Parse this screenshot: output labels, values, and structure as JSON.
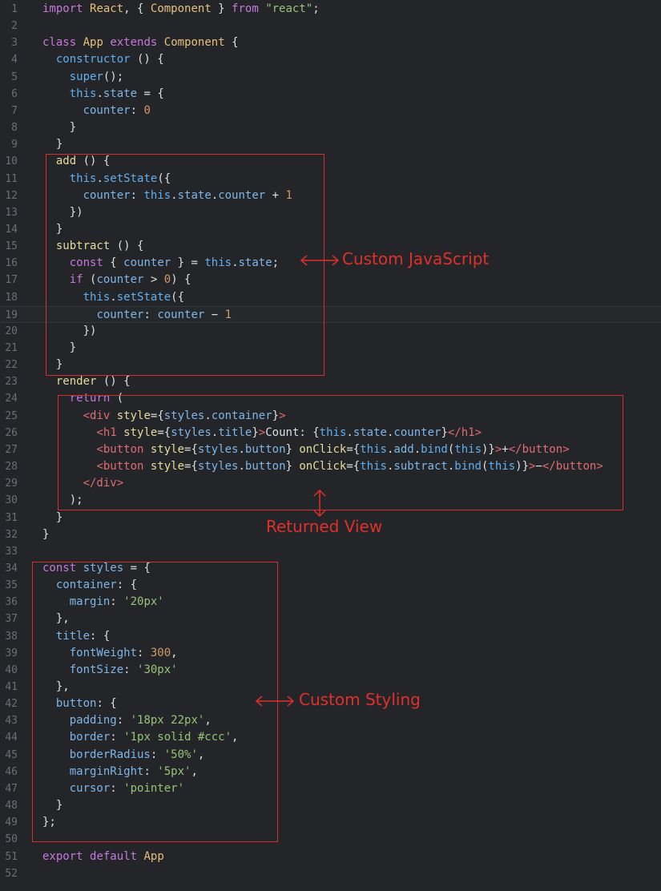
{
  "editor": {
    "lines": [
      [
        [
          "kw",
          "import"
        ],
        [
          "pl",
          " "
        ],
        [
          "cls",
          "React"
        ],
        [
          "pl",
          ", { "
        ],
        [
          "cls",
          "Component"
        ],
        [
          "pl",
          " } "
        ],
        [
          "kw",
          "from"
        ],
        [
          "pl",
          " "
        ],
        [
          "str",
          "\"react\""
        ],
        [
          "pl",
          ";"
        ]
      ],
      [],
      [
        [
          "kw",
          "class"
        ],
        [
          "pl",
          " "
        ],
        [
          "cls",
          "App"
        ],
        [
          "pl",
          " "
        ],
        [
          "kw",
          "extends"
        ],
        [
          "pl",
          " "
        ],
        [
          "cls",
          "Component"
        ],
        [
          "pl",
          " {"
        ]
      ],
      [
        [
          "pl",
          "  "
        ],
        [
          "fn",
          "constructor"
        ],
        [
          "pl",
          " () {"
        ]
      ],
      [
        [
          "pl",
          "    "
        ],
        [
          "fn",
          "super"
        ],
        [
          "pl",
          "();"
        ]
      ],
      [
        [
          "pl",
          "    "
        ],
        [
          "fn",
          "this"
        ],
        [
          "pl",
          "."
        ],
        [
          "prop",
          "state"
        ],
        [
          "pl",
          " = {"
        ]
      ],
      [
        [
          "pl",
          "      "
        ],
        [
          "prop",
          "counter"
        ],
        [
          "pl",
          ": "
        ],
        [
          "num",
          "0"
        ]
      ],
      [
        [
          "pl",
          "    }"
        ]
      ],
      [
        [
          "pl",
          "  }"
        ]
      ],
      [
        [
          "pl",
          "  "
        ],
        [
          "mth",
          "add"
        ],
        [
          "pl",
          " () {"
        ]
      ],
      [
        [
          "pl",
          "    "
        ],
        [
          "fn",
          "this"
        ],
        [
          "pl",
          "."
        ],
        [
          "fn",
          "setState"
        ],
        [
          "pl",
          "({"
        ]
      ],
      [
        [
          "pl",
          "      "
        ],
        [
          "prop",
          "counter"
        ],
        [
          "pl",
          ": "
        ],
        [
          "fn",
          "this"
        ],
        [
          "pl",
          "."
        ],
        [
          "prop",
          "state"
        ],
        [
          "pl",
          "."
        ],
        [
          "prop",
          "counter"
        ],
        [
          "pl",
          " + "
        ],
        [
          "num",
          "1"
        ]
      ],
      [
        [
          "pl",
          "    })"
        ]
      ],
      [
        [
          "pl",
          "  }"
        ]
      ],
      [
        [
          "pl",
          "  "
        ],
        [
          "mth",
          "subtract"
        ],
        [
          "pl",
          " () {"
        ]
      ],
      [
        [
          "pl",
          "    "
        ],
        [
          "kw",
          "const"
        ],
        [
          "pl",
          " { "
        ],
        [
          "prop",
          "counter"
        ],
        [
          "pl",
          " } = "
        ],
        [
          "fn",
          "this"
        ],
        [
          "pl",
          "."
        ],
        [
          "prop",
          "state"
        ],
        [
          "pl",
          ";"
        ]
      ],
      [
        [
          "pl",
          "    "
        ],
        [
          "kw",
          "if"
        ],
        [
          "pl",
          " ("
        ],
        [
          "prop",
          "counter"
        ],
        [
          "pl",
          " > "
        ],
        [
          "num",
          "0"
        ],
        [
          "pl",
          ") {"
        ]
      ],
      [
        [
          "pl",
          "      "
        ],
        [
          "fn",
          "this"
        ],
        [
          "pl",
          "."
        ],
        [
          "fn",
          "setState"
        ],
        [
          "pl",
          "({"
        ]
      ],
      [
        [
          "pl",
          "        "
        ],
        [
          "prop",
          "counter"
        ],
        [
          "pl",
          ": "
        ],
        [
          "prop",
          "counter"
        ],
        [
          "pl",
          " − "
        ],
        [
          "num",
          "1"
        ]
      ],
      [
        [
          "pl",
          "      })"
        ]
      ],
      [
        [
          "pl",
          "    }"
        ]
      ],
      [
        [
          "pl",
          "  }"
        ]
      ],
      [
        [
          "pl",
          "  "
        ],
        [
          "mth",
          "render"
        ],
        [
          "pl",
          " () {"
        ]
      ],
      [
        [
          "pl",
          "    "
        ],
        [
          "kw",
          "return"
        ],
        [
          "pl",
          " ("
        ]
      ],
      [
        [
          "pl",
          "      "
        ],
        [
          "tag",
          "<div"
        ],
        [
          "pl",
          " "
        ],
        [
          "mth",
          "style"
        ],
        [
          "pl",
          "={"
        ],
        [
          "prop",
          "styles"
        ],
        [
          "pl",
          "."
        ],
        [
          "prop",
          "container"
        ],
        [
          "pl",
          "}"
        ],
        [
          "tag",
          ">"
        ]
      ],
      [
        [
          "pl",
          "        "
        ],
        [
          "tag",
          "<h1"
        ],
        [
          "pl",
          " "
        ],
        [
          "mth",
          "style"
        ],
        [
          "pl",
          "={"
        ],
        [
          "prop",
          "styles"
        ],
        [
          "pl",
          "."
        ],
        [
          "prop",
          "title"
        ],
        [
          "pl",
          "}"
        ],
        [
          "tag",
          ">"
        ],
        [
          "pl",
          "Count: {"
        ],
        [
          "fn",
          "this"
        ],
        [
          "pl",
          "."
        ],
        [
          "prop",
          "state"
        ],
        [
          "pl",
          "."
        ],
        [
          "prop",
          "counter"
        ],
        [
          "pl",
          "}"
        ],
        [
          "tag",
          "</h1>"
        ]
      ],
      [
        [
          "pl",
          "        "
        ],
        [
          "tag",
          "<button"
        ],
        [
          "pl",
          " "
        ],
        [
          "mth",
          "style"
        ],
        [
          "pl",
          "={"
        ],
        [
          "prop",
          "styles"
        ],
        [
          "pl",
          "."
        ],
        [
          "prop",
          "button"
        ],
        [
          "pl",
          "} "
        ],
        [
          "mth",
          "onClick"
        ],
        [
          "pl",
          "={"
        ],
        [
          "fn",
          "this"
        ],
        [
          "pl",
          "."
        ],
        [
          "prop",
          "add"
        ],
        [
          "pl",
          "."
        ],
        [
          "fn",
          "bind"
        ],
        [
          "pl",
          "("
        ],
        [
          "fn",
          "this"
        ],
        [
          "pl",
          ")}"
        ],
        [
          "tag",
          ">"
        ],
        [
          "pl",
          "+"
        ],
        [
          "tag",
          "</button>"
        ]
      ],
      [
        [
          "pl",
          "        "
        ],
        [
          "tag",
          "<button"
        ],
        [
          "pl",
          " "
        ],
        [
          "mth",
          "style"
        ],
        [
          "pl",
          "={"
        ],
        [
          "prop",
          "styles"
        ],
        [
          "pl",
          "."
        ],
        [
          "prop",
          "button"
        ],
        [
          "pl",
          "} "
        ],
        [
          "mth",
          "onClick"
        ],
        [
          "pl",
          "={"
        ],
        [
          "fn",
          "this"
        ],
        [
          "pl",
          "."
        ],
        [
          "prop",
          "subtract"
        ],
        [
          "pl",
          "."
        ],
        [
          "fn",
          "bind"
        ],
        [
          "pl",
          "("
        ],
        [
          "fn",
          "this"
        ],
        [
          "pl",
          ")}"
        ],
        [
          "tag",
          ">"
        ],
        [
          "pl",
          "−"
        ],
        [
          "tag",
          "</button>"
        ]
      ],
      [
        [
          "pl",
          "      "
        ],
        [
          "tag",
          "</div>"
        ]
      ],
      [
        [
          "pl",
          "    );"
        ]
      ],
      [
        [
          "pl",
          "  }"
        ]
      ],
      [
        [
          "pl",
          "}"
        ]
      ],
      [],
      [
        [
          "kw",
          "const"
        ],
        [
          "pl",
          " "
        ],
        [
          "prop",
          "styles"
        ],
        [
          "pl",
          " = {"
        ]
      ],
      [
        [
          "pl",
          "  "
        ],
        [
          "prop",
          "container"
        ],
        [
          "pl",
          ": {"
        ]
      ],
      [
        [
          "pl",
          "    "
        ],
        [
          "prop",
          "margin"
        ],
        [
          "pl",
          ": "
        ],
        [
          "str",
          "'20px'"
        ]
      ],
      [
        [
          "pl",
          "  },"
        ]
      ],
      [
        [
          "pl",
          "  "
        ],
        [
          "prop",
          "title"
        ],
        [
          "pl",
          ": {"
        ]
      ],
      [
        [
          "pl",
          "    "
        ],
        [
          "prop",
          "fontWeight"
        ],
        [
          "pl",
          ": "
        ],
        [
          "num",
          "300"
        ],
        [
          "pl",
          ","
        ]
      ],
      [
        [
          "pl",
          "    "
        ],
        [
          "prop",
          "fontSize"
        ],
        [
          "pl",
          ": "
        ],
        [
          "str",
          "'30px'"
        ]
      ],
      [
        [
          "pl",
          "  },"
        ]
      ],
      [
        [
          "pl",
          "  "
        ],
        [
          "prop",
          "button"
        ],
        [
          "pl",
          ": {"
        ]
      ],
      [
        [
          "pl",
          "    "
        ],
        [
          "prop",
          "padding"
        ],
        [
          "pl",
          ": "
        ],
        [
          "str",
          "'18px 22px'"
        ],
        [
          "pl",
          ","
        ]
      ],
      [
        [
          "pl",
          "    "
        ],
        [
          "prop",
          "border"
        ],
        [
          "pl",
          ": "
        ],
        [
          "str",
          "'1px solid #ccc'"
        ],
        [
          "pl",
          ","
        ]
      ],
      [
        [
          "pl",
          "    "
        ],
        [
          "prop",
          "borderRadius"
        ],
        [
          "pl",
          ": "
        ],
        [
          "str",
          "'50%'"
        ],
        [
          "pl",
          ","
        ]
      ],
      [
        [
          "pl",
          "    "
        ],
        [
          "prop",
          "marginRight"
        ],
        [
          "pl",
          ": "
        ],
        [
          "str",
          "'5px'"
        ],
        [
          "pl",
          ","
        ]
      ],
      [
        [
          "pl",
          "    "
        ],
        [
          "prop",
          "cursor"
        ],
        [
          "pl",
          ": "
        ],
        [
          "str",
          "'pointer'"
        ]
      ],
      [
        [
          "pl",
          "  }"
        ]
      ],
      [
        [
          "pl",
          "};"
        ]
      ],
      [],
      [
        [
          "kw",
          "export"
        ],
        [
          "pl",
          " "
        ],
        [
          "kw",
          "default"
        ],
        [
          "pl",
          " "
        ],
        [
          "cls",
          "App"
        ]
      ],
      []
    ],
    "current_line": 19
  },
  "annotations": {
    "custom_javascript": "Custom JavaScript",
    "returned_view": "Returned View",
    "custom_styling": "Custom Styling"
  },
  "colors": {
    "annotation": "#e0302b",
    "background": "#232528"
  }
}
